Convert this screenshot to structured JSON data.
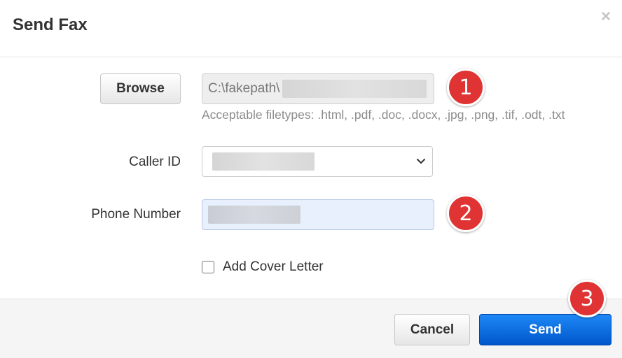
{
  "dialog": {
    "title": "Send Fax",
    "close_symbol": "×"
  },
  "file_upload": {
    "browse_label": "Browse",
    "path_prefix": "C:\\fakepath\\",
    "help_text": "Acceptable filetypes: .html, .pdf, .doc, .docx, .jpg, .png, .tif, .odt, .txt"
  },
  "caller_id": {
    "label": "Caller ID"
  },
  "phone_number": {
    "label": "Phone Number"
  },
  "cover_letter": {
    "label": "Add Cover Letter",
    "checked": false
  },
  "footer": {
    "cancel_label": "Cancel",
    "send_label": "Send"
  },
  "annotations": {
    "step_1": "1",
    "step_2": "2",
    "step_3": "3"
  },
  "colors": {
    "send_button": "#0b6fe0",
    "marker": "#e03333",
    "phone_autofill_bg": "#e8f0fe"
  },
  "icons": {
    "close": "close-icon",
    "dropdown": "chevron-down-icon"
  }
}
